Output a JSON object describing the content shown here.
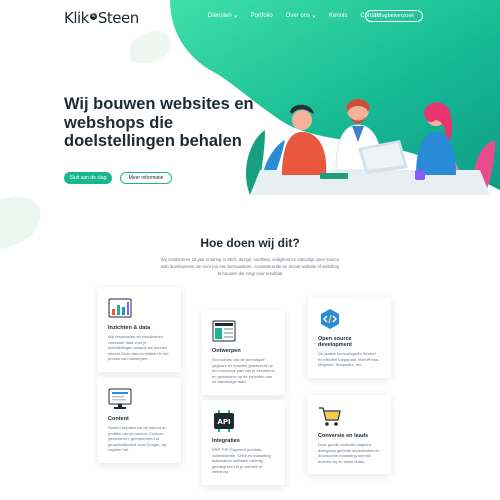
{
  "brand": {
    "logo_left": "Klik",
    "logo_amp": "&",
    "logo_right": "Steen"
  },
  "nav": {
    "items": [
      {
        "label": "Diensten",
        "has_dropdown": true
      },
      {
        "label": "Portfolio",
        "has_dropdown": false
      },
      {
        "label": "Over ons",
        "has_dropdown": true
      },
      {
        "label": "Kennis",
        "has_dropdown": false
      },
      {
        "label": "Contact",
        "has_dropdown": false
      }
    ],
    "cta": "Terugbelverzoek"
  },
  "hero": {
    "title": "Wij bouwen websites en webshops die doelstellingen behalen",
    "primary_button": "Sluit aan de slag",
    "secondary_button": "Meer informatie"
  },
  "section": {
    "title": "Hoe doen wij dit?",
    "intro": "Wij combineren 15 jaar ervaring in SEO, design, snelheid, veiligheid en natuurlijk open source web development om voor jou een betrouwbare, converterende en mooie website of webshop te bouwen die zorgt voor resultaat"
  },
  "cards": [
    {
      "icon": "chart-icon",
      "title": "Inzichten & data",
      "text": "Wij verzamelen en visualiseren relevante data voor je doelstellingen waarop we kunnen sturen! Deze data is leidend in het proces van ontwerpen."
    },
    {
      "icon": "wireframe-icon",
      "title": "Ontwerpen",
      "text": "Een schets van de benodigde pagina's en functies gebaseerd op het conversie pad van je bezoekers en gebaseerd op de inzichten van de aanwezige data."
    },
    {
      "icon": "code-icon",
      "title": "Open source development",
      "text": "De laatste technologieën flexibel en efficiënt toegepast. WordPress, Magento, Shopware, etc."
    },
    {
      "icon": "monitor-icon",
      "title": "Content",
      "text": "Samen bepalen we de inhoud en profiles van je content. Custom geschreven, geïmporteerd of geoptimaliseerd voor Google, wij regelen het."
    },
    {
      "icon": "api-icon",
      "title": "Integraties",
      "text": "ERP, PIP, Payment provider, Administratie, CRM en marketing automation software volledig geïntegreerd in je website of webshop."
    },
    {
      "icon": "cart-icon",
      "title": "Conversie en leads",
      "text": "Door goede vindbare pagina's doelgroep gerichte advertenties en doordachte marketing funnels leveren wij de beste leads."
    }
  ],
  "colors": {
    "accent": "#17b890",
    "accent_light": "#3fd6a8",
    "text": "#1f2a30",
    "muted": "#6c7780"
  }
}
